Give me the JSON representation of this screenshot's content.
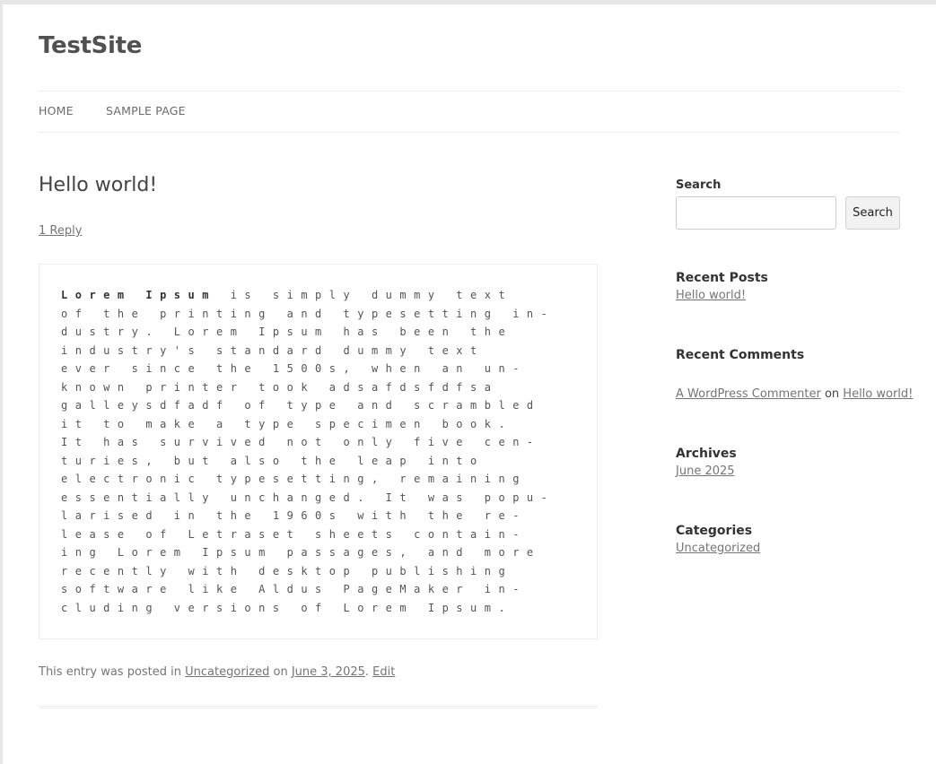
{
  "site": {
    "title": "TestSite"
  },
  "nav": {
    "items": [
      {
        "label": "HOME"
      },
      {
        "label": "SAMPLE PAGE"
      }
    ]
  },
  "post": {
    "title": "Hello world!",
    "reply_link": "1 Reply",
    "code_lines": [
      {
        "bold": "Lorem Ipsum",
        "text": " is simply dummy text"
      },
      {
        "bold": "",
        "text": "of the printing and typesetting in-"
      },
      {
        "bold": "",
        "text": "dustry. Lorem Ipsum has been the"
      },
      {
        "bold": "",
        "text": "industry's standard dummy text"
      },
      {
        "bold": "",
        "text": "ever since the 1500s, when an un-"
      },
      {
        "bold": "",
        "text": "known printer took adsafdsfdfsa"
      },
      {
        "bold": "",
        "text": "galleysdfadf of type and scrambled"
      },
      {
        "bold": "",
        "text": "it to make a type specimen book."
      },
      {
        "bold": "",
        "text": "It has survived not only five cen-"
      },
      {
        "bold": "",
        "text": "turies, but also the leap into"
      },
      {
        "bold": "",
        "text": "electronic typesetting, remaining"
      },
      {
        "bold": "",
        "text": "essentially unchanged. It was popu-"
      },
      {
        "bold": "",
        "text": "larised in the 1960s with the re-"
      },
      {
        "bold": "",
        "text": "lease of Letraset sheets contain-"
      },
      {
        "bold": "",
        "text": "ing Lorem Ipsum passages, and more"
      },
      {
        "bold": "",
        "text": "recently with desktop publishing"
      },
      {
        "bold": "",
        "text": "software like Aldus PageMaker in-"
      },
      {
        "bold": "",
        "text": "cluding versions of Lorem Ipsum."
      }
    ],
    "meta": {
      "prefix": "This entry was posted in ",
      "category": "Uncategorized",
      "on": " on ",
      "date": "June 3, 2025",
      "sep": ". ",
      "edit": "Edit"
    }
  },
  "sidebar": {
    "search": {
      "label": "Search",
      "button": "Search",
      "value": "",
      "placeholder": ""
    },
    "recent_posts": {
      "title": "Recent Posts",
      "items": [
        "Hello world!"
      ]
    },
    "recent_comments": {
      "title": "Recent Comments",
      "author": "A WordPress Commenter",
      "on": " on ",
      "post": "Hello world!"
    },
    "archives": {
      "title": "Archives",
      "items": [
        "June 2025"
      ]
    },
    "categories": {
      "title": "Categories",
      "items": [
        "Uncategorized"
      ]
    }
  }
}
